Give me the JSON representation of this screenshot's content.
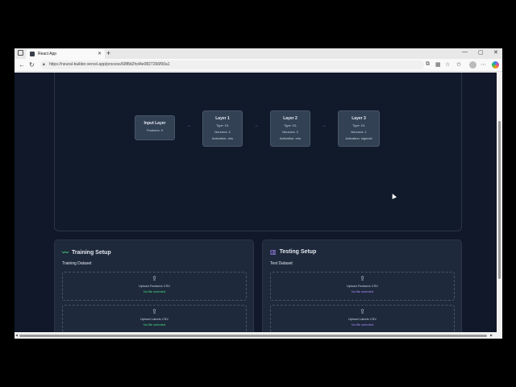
{
  "browser": {
    "tab_title": "React App",
    "new_tab": "+",
    "url": "https://neural-builder.vercel.app/process/68f8d2fcd4e0827266f90a1",
    "window_controls": [
      "—",
      "▢",
      "✕"
    ]
  },
  "network": {
    "layers": [
      {
        "title": "Input Layer",
        "lines": [
          "Features: 9"
        ]
      },
      {
        "title": "Layer 1",
        "lines": [
          "Type: DL",
          "Neurons: 4",
          "Activation: relu"
        ]
      },
      {
        "title": "Layer 2",
        "lines": [
          "Type: DL",
          "Neurons: 3",
          "Activation: relu"
        ]
      },
      {
        "title": "Layer 3",
        "lines": [
          "Type: DL",
          "Neurons: 1",
          "Activation: sigmoid"
        ]
      }
    ],
    "arrow": "→"
  },
  "training": {
    "title": "Training Setup",
    "dataset_label": "Training Dataset",
    "features_upload": "Upload Features CSV",
    "features_status": "No file selected",
    "labels_upload": "Upload Labels CSV",
    "labels_status": "No file selected",
    "icon": "activity-icon",
    "accent": "#4ade80"
  },
  "testing": {
    "title": "Testing Setup",
    "dataset_label": "Test Dataset",
    "features_upload": "Upload Features CSV",
    "features_status": "No file selected",
    "labels_upload": "Upload Labels CSV",
    "labels_status": "No file selected",
    "icon": "bar-chart-icon",
    "accent": "#a78bfa"
  }
}
